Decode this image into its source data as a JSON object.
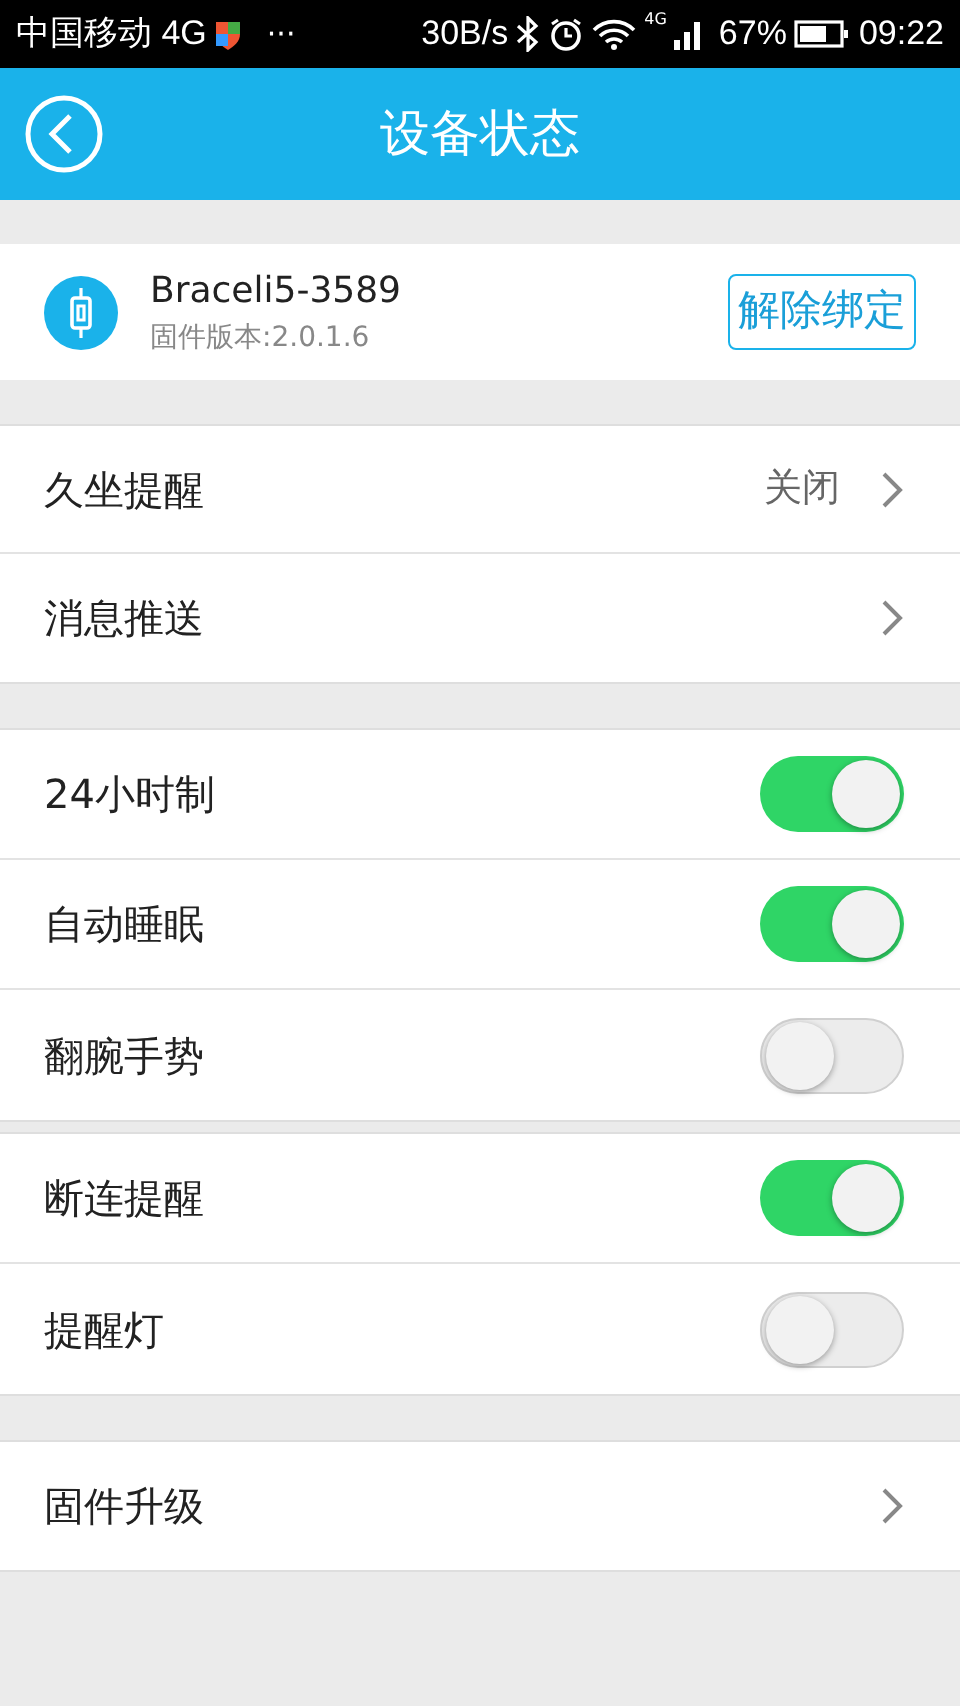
{
  "status_bar": {
    "carrier": "中国移动 4G",
    "more": "···",
    "speed": "30B/s",
    "network": "4G",
    "battery": "67%",
    "time": "09:22"
  },
  "header": {
    "title": "设备状态"
  },
  "device": {
    "name": "Braceli5-3589",
    "firmware": "固件版本:2.0.1.6",
    "unbind": "解除绑定"
  },
  "groups": [
    {
      "rows": [
        {
          "kind": "link",
          "label": "久坐提醒",
          "value": "关闭"
        },
        {
          "kind": "link",
          "label": "消息推送"
        }
      ]
    },
    {
      "rows": [
        {
          "kind": "toggle",
          "label": "24小时制",
          "on": true
        },
        {
          "kind": "toggle",
          "label": "自动睡眠",
          "on": true
        },
        {
          "kind": "toggle",
          "label": "翻腕手势",
          "on": false
        }
      ]
    },
    {
      "rows": [
        {
          "kind": "toggle",
          "label": "断连提醒",
          "on": true
        },
        {
          "kind": "toggle",
          "label": "提醒灯",
          "on": false
        }
      ]
    },
    {
      "rows": [
        {
          "kind": "link",
          "label": "固件升级"
        }
      ]
    }
  ]
}
